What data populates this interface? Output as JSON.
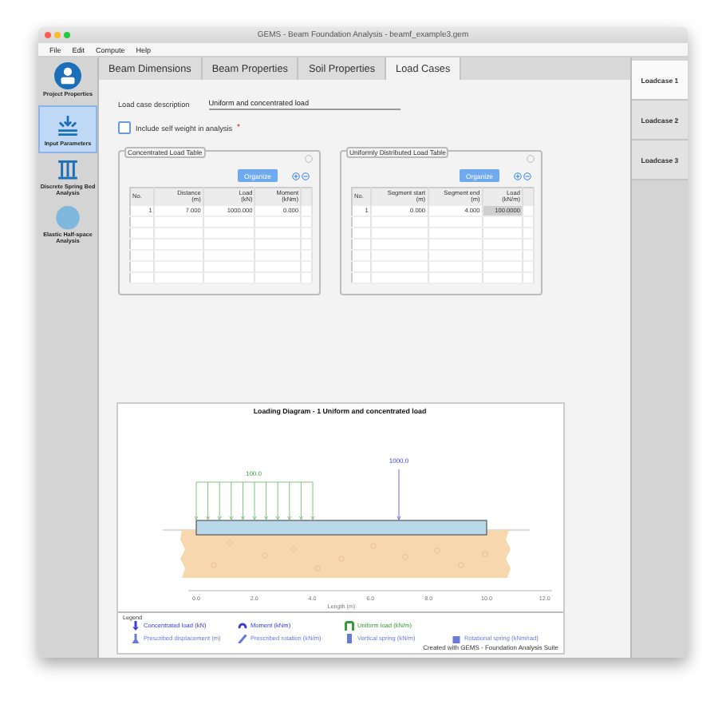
{
  "window": {
    "title": "GEMS - Beam Foundation Analysis - beamf_example3.gem"
  },
  "menu": [
    "File",
    "Edit",
    "Compute",
    "Help"
  ],
  "sidebar": {
    "items": [
      {
        "label": "Project Properties",
        "selected": false,
        "kind": "project"
      },
      {
        "label": "Input Parameters",
        "selected": true,
        "kind": "input"
      },
      {
        "label": "Discrete Spring Bed Analysis",
        "selected": false,
        "kind": "spring"
      },
      {
        "label": "Elastic Half-space Analysis",
        "selected": false,
        "kind": "halfspace"
      }
    ]
  },
  "tabs": [
    {
      "label": "Beam Dimensions",
      "selected": false
    },
    {
      "label": "Beam Properties",
      "selected": false
    },
    {
      "label": "Soil Properties",
      "selected": false
    },
    {
      "label": "Load Cases",
      "selected": true
    }
  ],
  "load_case_tabs": [
    {
      "label": "Loadcase 1",
      "selected": true
    },
    {
      "label": "Loadcase 2",
      "selected": false
    },
    {
      "label": "Loadcase 3",
      "selected": false
    }
  ],
  "description": {
    "label": "Load case description",
    "value": "Uniform and concentrated load"
  },
  "self_weight": {
    "label": "Include self weight in analysis",
    "required_mark": "*",
    "checked": false
  },
  "tables": [
    {
      "title": "Concentrated Load Table",
      "button": "Organize",
      "columns": [
        "No.",
        "Distance\n(m)",
        "Load\n(kN)",
        "Moment\n(kNm)"
      ],
      "rows": [
        {
          "cells": [
            {
              "text": "1",
              "selected": false
            },
            {
              "text": "7.000",
              "selected": false
            },
            {
              "text": "1000.000",
              "selected": false
            },
            {
              "text": "0.000",
              "selected": false
            }
          ]
        }
      ]
    },
    {
      "title": "Uniformly Distributed Load Table",
      "button": "Organize",
      "columns": [
        "No.",
        "Segment start\n(m)",
        "Segment end\n(m)",
        "Load\n(kN/m)"
      ],
      "rows": [
        {
          "cells": [
            {
              "text": "1",
              "selected": false
            },
            {
              "text": "0.000",
              "selected": false
            },
            {
              "text": "4.000",
              "selected": false
            },
            {
              "text": "100.0000",
              "selected": true
            }
          ]
        }
      ]
    }
  ],
  "diagram": {
    "title": "Loading Diagram - 1 Uniform and concentrated load",
    "uniform_load_label": "100.0",
    "point_load_label": "1000.0",
    "xticks": [
      "0.0",
      "2.0",
      "4.0",
      "6.0",
      "8.0",
      "10.0",
      "12.0"
    ],
    "xlabel": "Length (m)"
  },
  "legend": {
    "title": "Legend",
    "items": [
      {
        "label": "Concentrated load (kN)",
        "kind": "concentrated",
        "color": "#3a3ae0"
      },
      {
        "label": "Moment (kNm)",
        "kind": "moment",
        "color": "#3a3ae0"
      },
      {
        "label": "Uniform load (kN/m)",
        "kind": "uniform",
        "color": "#3a9a3a"
      },
      {
        "label": "Prescribed displacement (m)",
        "kind": "displacement",
        "color": "#6a7ad8"
      },
      {
        "label": "Prescribed rotation (kN/m)",
        "kind": "rotation",
        "color": "#6a7ad8"
      },
      {
        "label": "Vertical spring (kN/m)",
        "kind": "vspring",
        "color": "#6a7ad8"
      },
      {
        "label": "Rotational spring (kNm/rad)",
        "kind": "rspring",
        "color": "#6a7ad8"
      }
    ],
    "credit": "Created with GEMS - Foundation Analysis Suite"
  }
}
